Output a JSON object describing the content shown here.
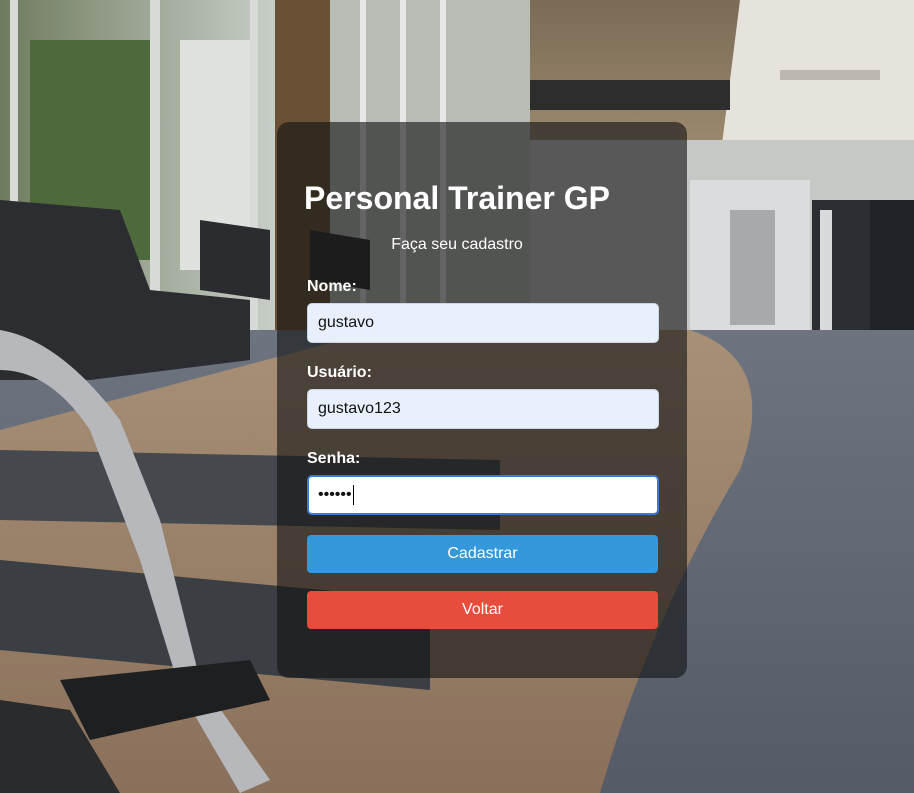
{
  "header": {
    "title": "Personal Trainer GP",
    "subtitle": "Faça seu cadastro"
  },
  "form": {
    "nome": {
      "label": "Nome:",
      "value": "gustavo"
    },
    "usuario": {
      "label": "Usuário:",
      "value": "gustavo123"
    },
    "senha": {
      "label": "Senha:",
      "value": "••••••"
    }
  },
  "buttons": {
    "cadastrar": "Cadastrar",
    "voltar": "Voltar"
  },
  "colors": {
    "primary": "#3498db",
    "danger": "#e74c3c",
    "input_bg": "#e8f0fe"
  }
}
